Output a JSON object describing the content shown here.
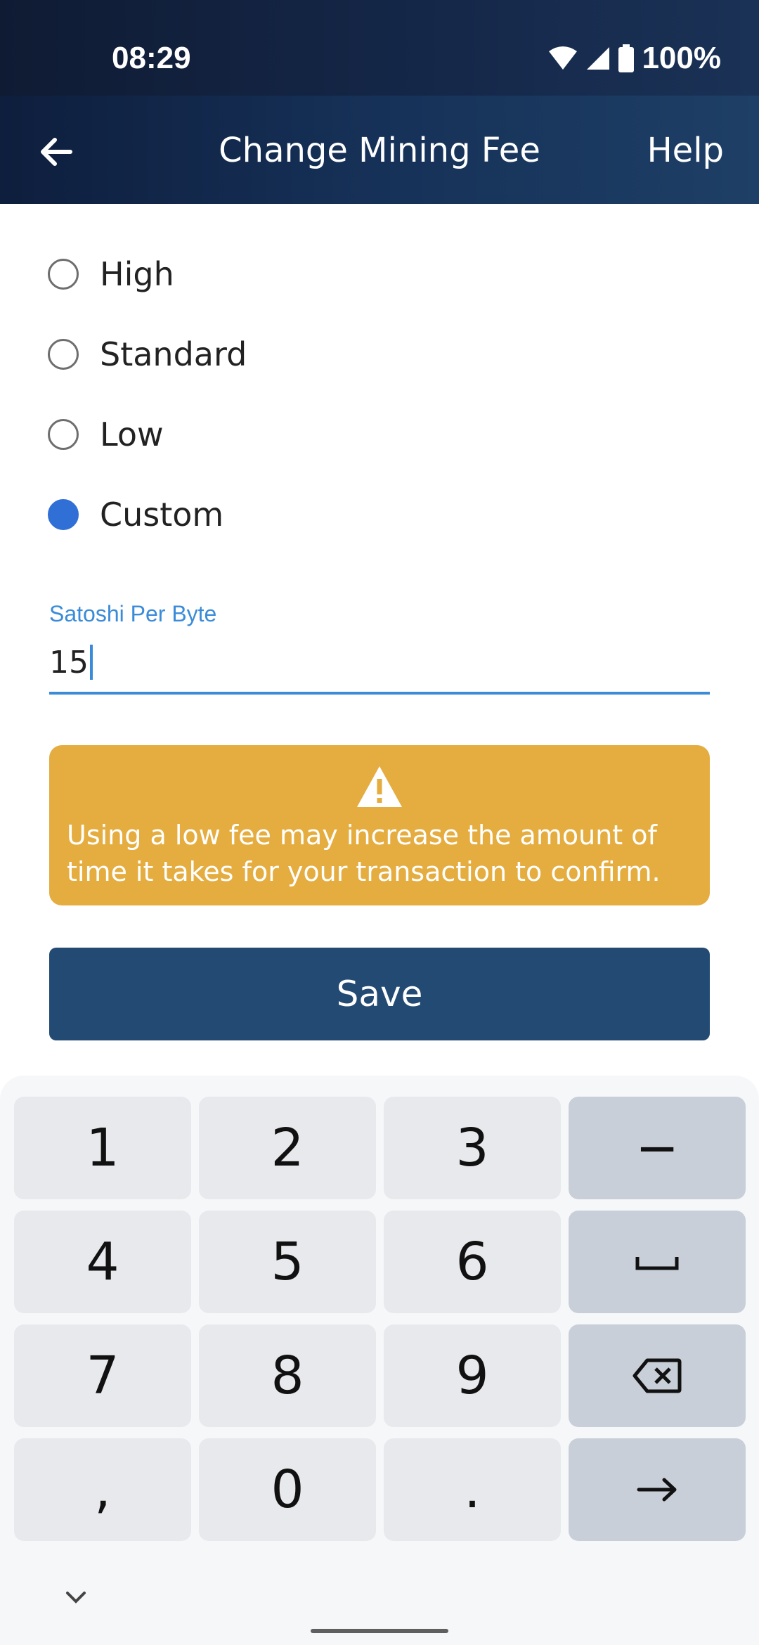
{
  "status_bar": {
    "time": "08:29",
    "battery": "100%"
  },
  "header": {
    "title": "Change Mining Fee",
    "help_label": "Help"
  },
  "fee_options": [
    {
      "label": "High",
      "checked": false
    },
    {
      "label": "Standard",
      "checked": false
    },
    {
      "label": "Low",
      "checked": false
    },
    {
      "label": "Custom",
      "checked": true
    }
  ],
  "custom_fee": {
    "label": "Satoshi Per Byte",
    "value": "15"
  },
  "warning": {
    "text": "Using a low fee may increase the amount of time it takes for your transaction to confirm."
  },
  "save_label": "Save",
  "keyboard": {
    "rows": [
      [
        "1",
        "2",
        "3",
        "−"
      ],
      [
        "4",
        "5",
        "6",
        "␣"
      ],
      [
        "7",
        "8",
        "9",
        "⌫"
      ],
      [
        ",",
        "0",
        ".",
        "→"
      ]
    ]
  },
  "colors": {
    "accent": "#2f6fd6",
    "warning": "#e5ad40",
    "primary_button": "#234a73"
  }
}
